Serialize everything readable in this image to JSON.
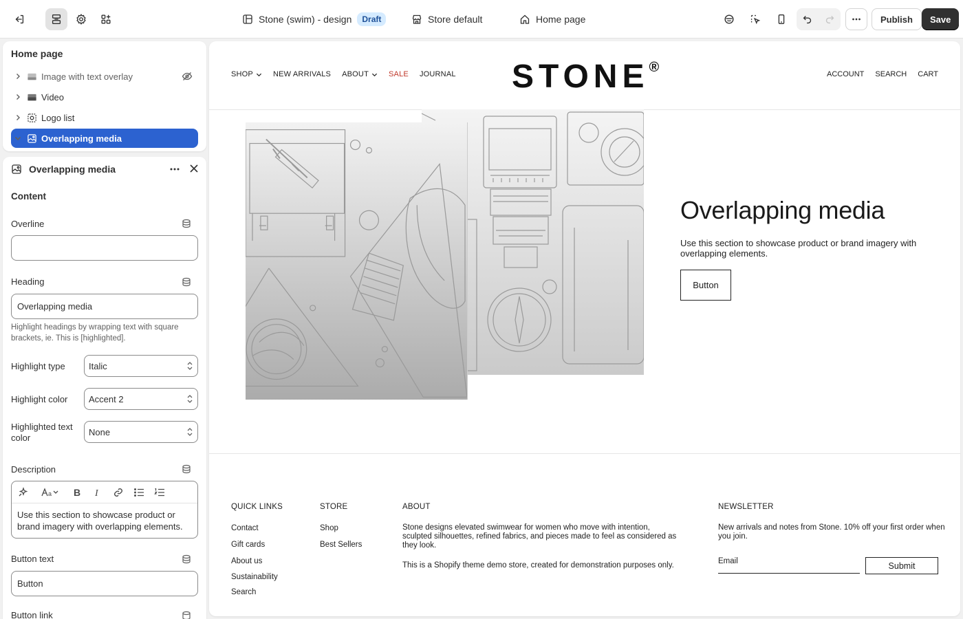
{
  "topbar": {
    "theme_name": "Stone (swim) - design",
    "draft_badge": "Draft",
    "store_label": "Store default",
    "page_label": "Home page",
    "publish_label": "Publish",
    "save_label": "Save"
  },
  "sidebar": {
    "title": "Home page",
    "tree": [
      {
        "label": "Image with text overlay",
        "icon": "image-overlay-icon"
      },
      {
        "label": "Video",
        "icon": "video-icon"
      },
      {
        "label": "Logo list",
        "icon": "logo-list-icon"
      },
      {
        "label": "Overlapping media",
        "icon": "media-icon"
      }
    ],
    "section_title": "Overlapping media",
    "content_heading": "Content",
    "overline_label": "Overline",
    "overline_value": "",
    "heading_label": "Heading",
    "heading_value": "Overlapping media",
    "heading_hint": "Highlight headings by wrapping text with square brackets, ie. This is [highlighted].",
    "highlight_type_label": "Highlight type",
    "highlight_type_value": "Italic",
    "highlight_color_label": "Highlight color",
    "highlight_color_value": "Accent 2",
    "highlighted_text_color_label": "Highlighted text color",
    "highlighted_text_color_value": "None",
    "description_label": "Description",
    "description_value": "Use this section to showcase product or brand imagery with overlapping elements.",
    "button_text_label": "Button text",
    "button_text_value": "Button",
    "button_link_label": "Button link"
  },
  "preview": {
    "nav": {
      "shop": "SHOP",
      "new_arrivals": "NEW ARRIVALS",
      "about": "ABOUT",
      "sale": "SALE",
      "journal": "JOURNAL",
      "account": "ACCOUNT",
      "search": "SEARCH",
      "cart": "CART"
    },
    "logo": "STONE",
    "logo_mark": "®",
    "section": {
      "title": "Overlapping media",
      "description": "Use this section to showcase product or brand imagery with overlapping elements.",
      "button": "Button"
    },
    "footer": {
      "quick_links_heading": "QUICK LINKS",
      "quick_links": [
        "Contact",
        "Gift cards",
        "About us",
        "Sustainability",
        "Search"
      ],
      "store_heading": "STORE",
      "store_links": [
        "Shop",
        "Best Sellers"
      ],
      "about_heading": "ABOUT",
      "about_p1": "Stone designs elevated swimwear for women who move with intention, sculpted silhouettes, refined fabrics, and pieces made to feel as considered as they look.",
      "about_p2": "This is a Shopify theme demo store, created for demonstration purposes only.",
      "newsletter_heading": "NEWSLETTER",
      "newsletter_text": "New arrivals and notes from Stone. 10% off your first order when you join.",
      "email_placeholder": "Email",
      "submit_label": "Submit"
    }
  },
  "colors": {
    "accent_blue": "#2c62d0",
    "sale_red": "#c0392b",
    "dark_button": "#303030",
    "badge_bg": "#d5ebff"
  }
}
